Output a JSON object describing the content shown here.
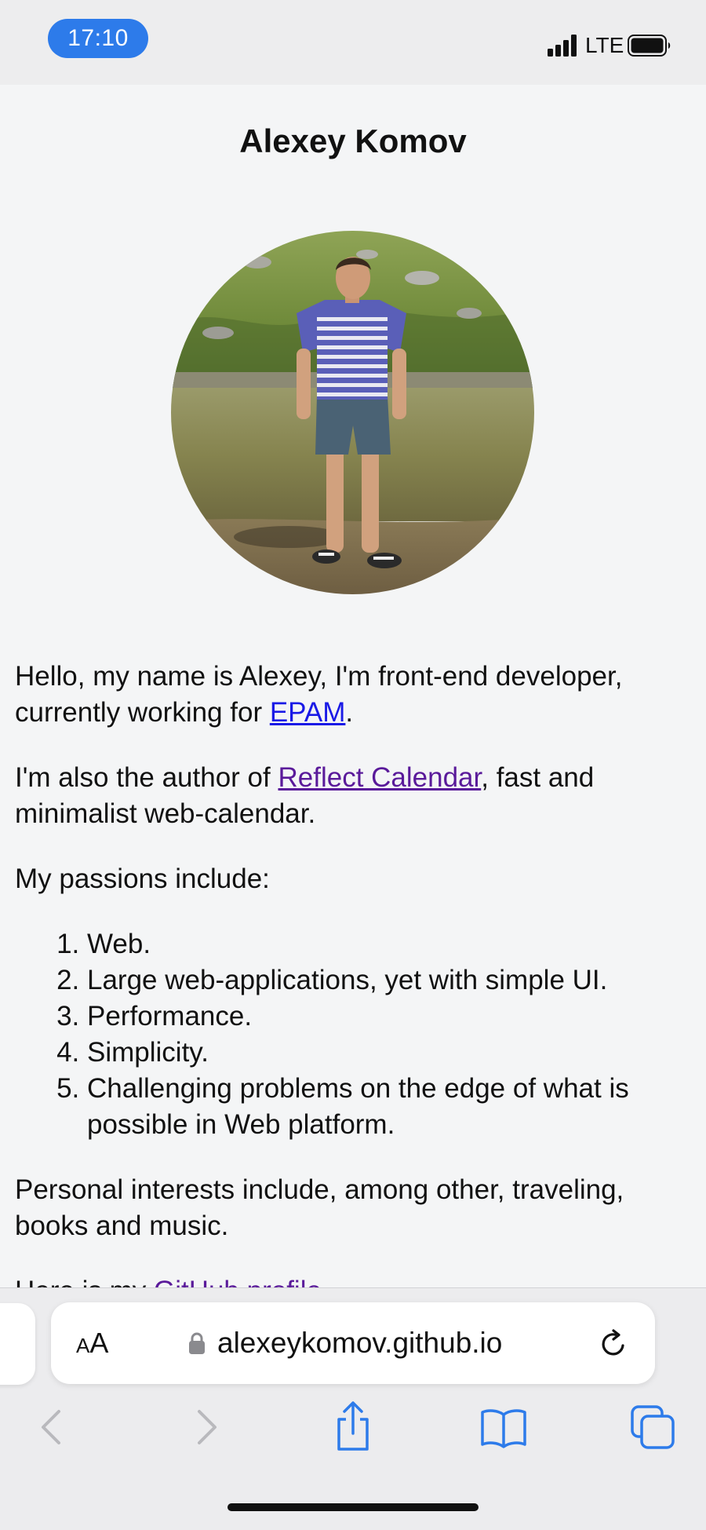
{
  "status_bar": {
    "time": "17:10",
    "network": "LTE"
  },
  "page": {
    "title": "Alexey Komov",
    "avatar_alt": "photo-of-person-standing-by-lake",
    "intro": {
      "text_before": "Hello, my name is Alexey, I'm front-end developer, currently working for ",
      "link": "EPAM",
      "text_after": "."
    },
    "author": {
      "text_before": "I'm also the author of ",
      "link": "Reflect Calendar",
      "text_after": ", fast and minimalist web-calendar."
    },
    "passions_heading": "My passions include:",
    "passions": [
      "Web.",
      "Large web-applications, yet with simple UI.",
      "Performance.",
      "Simplicity.",
      "Challenging problems on the edge of what is possible in Web platform."
    ],
    "interests": "Personal interests include, among other, traveling, books and music.",
    "partial_line": {
      "text_before": "Here is my ",
      "link": "GitHub profile"
    }
  },
  "browser": {
    "text_size_button": {
      "small": "A",
      "large": "A"
    },
    "url": "alexeykomov.github.io"
  },
  "icons": {
    "lock": "lock-icon",
    "reload": "reload-icon",
    "back": "chevron-left-icon",
    "forward": "chevron-right-icon",
    "share": "share-icon",
    "bookmarks": "book-icon",
    "tabs": "tabs-icon"
  },
  "colors": {
    "time_pill": "#2d7bea",
    "link": "#1a1ae6",
    "visited_link": "#5a1a9a",
    "toolbar_accent": "#2d7bea",
    "toolbar_disabled": "#b9b9bd"
  }
}
